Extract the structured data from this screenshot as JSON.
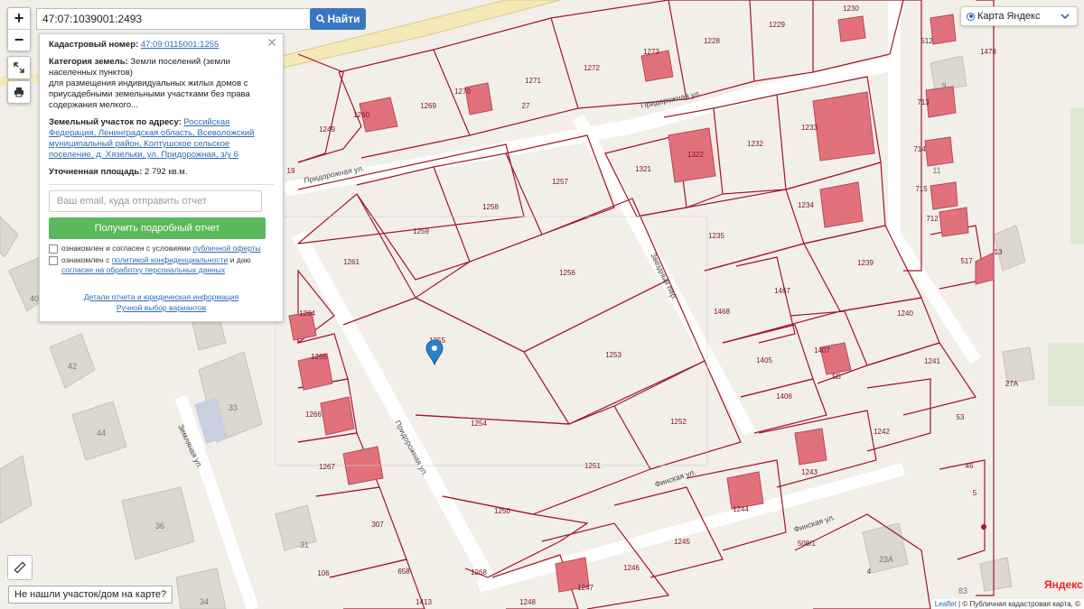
{
  "search": {
    "value": "47:07:1039001:2493",
    "button_label": "Найти"
  },
  "info": {
    "cad_label": "Кадастровый номер:",
    "cad_number": "47:09:0115001:1255",
    "category_label": "Категория земель:",
    "category_value": "Земли поселений (земли населенных пунктов)",
    "purpose": "для размещения индивидуальных жилых домов с приусадебными земельными участками без права содержания мелкого...",
    "address_label": "Земельный участок по адресу:",
    "address_value": "Российская Федерация, Ленинградская область, Всеволожский муниципальный район, Колтушское сельское поселение, д. Хязельки, ул. Придорожная, з/у 6",
    "area_label": "Уточненная площадь:",
    "area_value": "2 792 кв.м.",
    "email_placeholder": "Ваш email, куда отправить отчет",
    "report_button": "Получить подробный отчет",
    "consent1_prefix": "ознакомлен и согласен с условиями ",
    "consent1_link": "публичной оферты",
    "consent2_prefix": "ознакомлен с ",
    "consent2_link": "политикой конфиденциальности",
    "consent2_mid": " и даю ",
    "consent2_link2": "согласие на обработку персональных данных",
    "details_link": "Детали отчета и юридическая информация",
    "manual_link": "Ручной выбор вариантов"
  },
  "layer": {
    "label": "Карта Яндекс"
  },
  "notfound_label": "Не нашли участок/дом на карте?",
  "attribution": {
    "leaflet": "Leaflet",
    "sep": " | © ",
    "text": "Публичная кадастровая карта, ©"
  },
  "yandex_logo": "Яндекс",
  "map": {
    "plots": [
      "1230",
      "1228",
      "1229",
      "512",
      "1478",
      "1273",
      "1271",
      "1272",
      "1270",
      "27",
      "1269",
      "1260",
      "1249",
      "1321",
      "1322",
      "1232",
      "1233",
      "1257",
      "1258",
      "1259",
      "1261",
      "1235",
      "1234",
      "1239",
      "1256",
      "1264",
      "1255",
      "1253",
      "1468",
      "1467",
      "1405",
      "1407",
      "1406",
      "1240",
      "1241",
      "1265",
      "1266",
      "1267",
      "1254",
      "1252",
      "1251",
      "1242",
      "1243",
      "1250",
      "1244",
      "307",
      "1245",
      "1246",
      "1247",
      "658",
      "1268",
      "1248",
      "1413",
      "508/1",
      "106",
      "713",
      "714",
      "715",
      "712",
      "517",
      "46",
      "5",
      "4",
      "13",
      "27А",
      "53",
      "5Б",
      "19"
    ],
    "addresses": [
      "42",
      "33",
      "44",
      "36",
      "31",
      "34",
      "40",
      "23А",
      "9",
      "11",
      "83"
    ],
    "streets": [
      "Придорожная ул.",
      "Придорожная ул.",
      "Звездный пер.",
      "Придорожная ул.",
      "Финская ул.",
      "Финская ул.",
      "Земляная ул."
    ]
  }
}
